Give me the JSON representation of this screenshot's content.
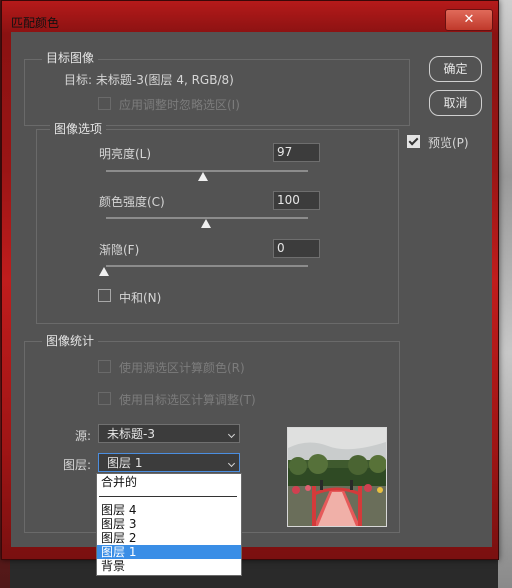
{
  "window": {
    "title": "匹配颜色",
    "close_label": "✕"
  },
  "target_group": {
    "title": "目标图像",
    "target_text": "目标:  未标题-3(图层 4, RGB/8)",
    "ignore_selection_label": "应用调整时忽略选区(I)"
  },
  "options_group": {
    "title": "图像选项",
    "luminance": {
      "label": "明亮度(L)",
      "value": "97",
      "level": 0.48
    },
    "color_intensity": {
      "label": "颜色强度(C)",
      "value": "100",
      "level": 0.5
    },
    "fade": {
      "label": "渐隐(F)",
      "value": "0",
      "level": 0.0
    },
    "neutralize_label": "中和(N)"
  },
  "buttons": {
    "ok": "确定",
    "cancel": "取消",
    "preview_label": "预览(P)"
  },
  "stats_group": {
    "title": "图像统计",
    "use_source_selection_label": "使用源选区计算颜色(R)",
    "use_target_selection_label": "使用目标选区计算调整(T)",
    "source_label": "源:",
    "source_value": "未标题-3",
    "layer_label": "图层:",
    "layer_value": "图层 1"
  },
  "layer_dropdown": {
    "items": [
      "合并的",
      "图层 4",
      "图层 3",
      "图层 2",
      "图层 1",
      "背景"
    ],
    "selected_index": 4
  },
  "colors": {
    "title_bar": "#a01515",
    "panel": "#535353",
    "accent": "#3a8ee6"
  }
}
